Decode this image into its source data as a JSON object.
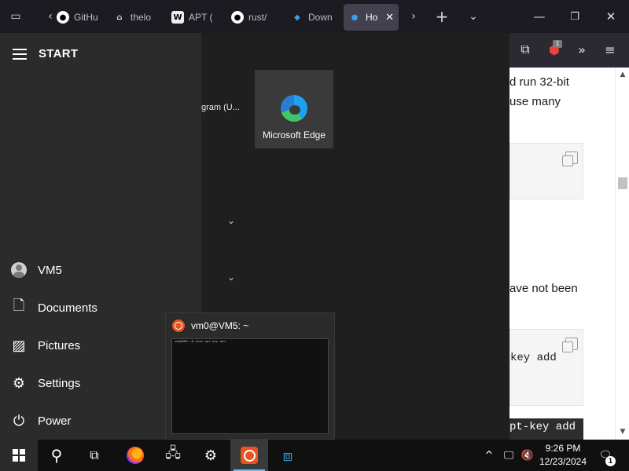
{
  "browser": {
    "tabs": [
      {
        "label": "GitHu",
        "favicon": "github"
      },
      {
        "label": "thelo",
        "favicon": "library"
      },
      {
        "label": "APT (",
        "favicon": "wikipedia"
      },
      {
        "label": "rust/",
        "favicon": "github"
      },
      {
        "label": "Down",
        "favicon": "vscode"
      },
      {
        "label": "Ho",
        "favicon": "site",
        "active": true
      }
    ],
    "toolbar": {
      "extension_badge": "1"
    }
  },
  "page": {
    "lines": [
      {
        "text": "d run 32-bit"
      },
      {
        "text": "use many"
      },
      {
        "text": "ave not been"
      }
    ],
    "code_blocks": [
      {
        "text": ""
      },
      {
        "text": "key add"
      }
    ],
    "dark_code": "pt-key add -"
  },
  "start_menu": {
    "title": "START",
    "app_partial": "gram (U...",
    "tile": {
      "label": "Microsoft Edge"
    },
    "rail_items": [
      {
        "label": "VM5",
        "icon": "user-avatar-icon"
      },
      {
        "label": "Documents",
        "icon": "document-icon"
      },
      {
        "label": "Pictures",
        "icon": "pictures-icon"
      },
      {
        "label": "Settings",
        "icon": "gear-icon"
      },
      {
        "label": "Power",
        "icon": "power-icon"
      }
    ]
  },
  "preview": {
    "title": "vm0@VM5: ~",
    "terminal_line": "vm0@VM5:~$ sudo apt-key add"
  },
  "taskbar": {
    "time": "9:26 PM",
    "date": "12/23/2024",
    "notification_count": "1"
  },
  "colors": {
    "accent": "#76b9ed",
    "ubuntu": "#e95420",
    "tab_active": "#42414d"
  }
}
